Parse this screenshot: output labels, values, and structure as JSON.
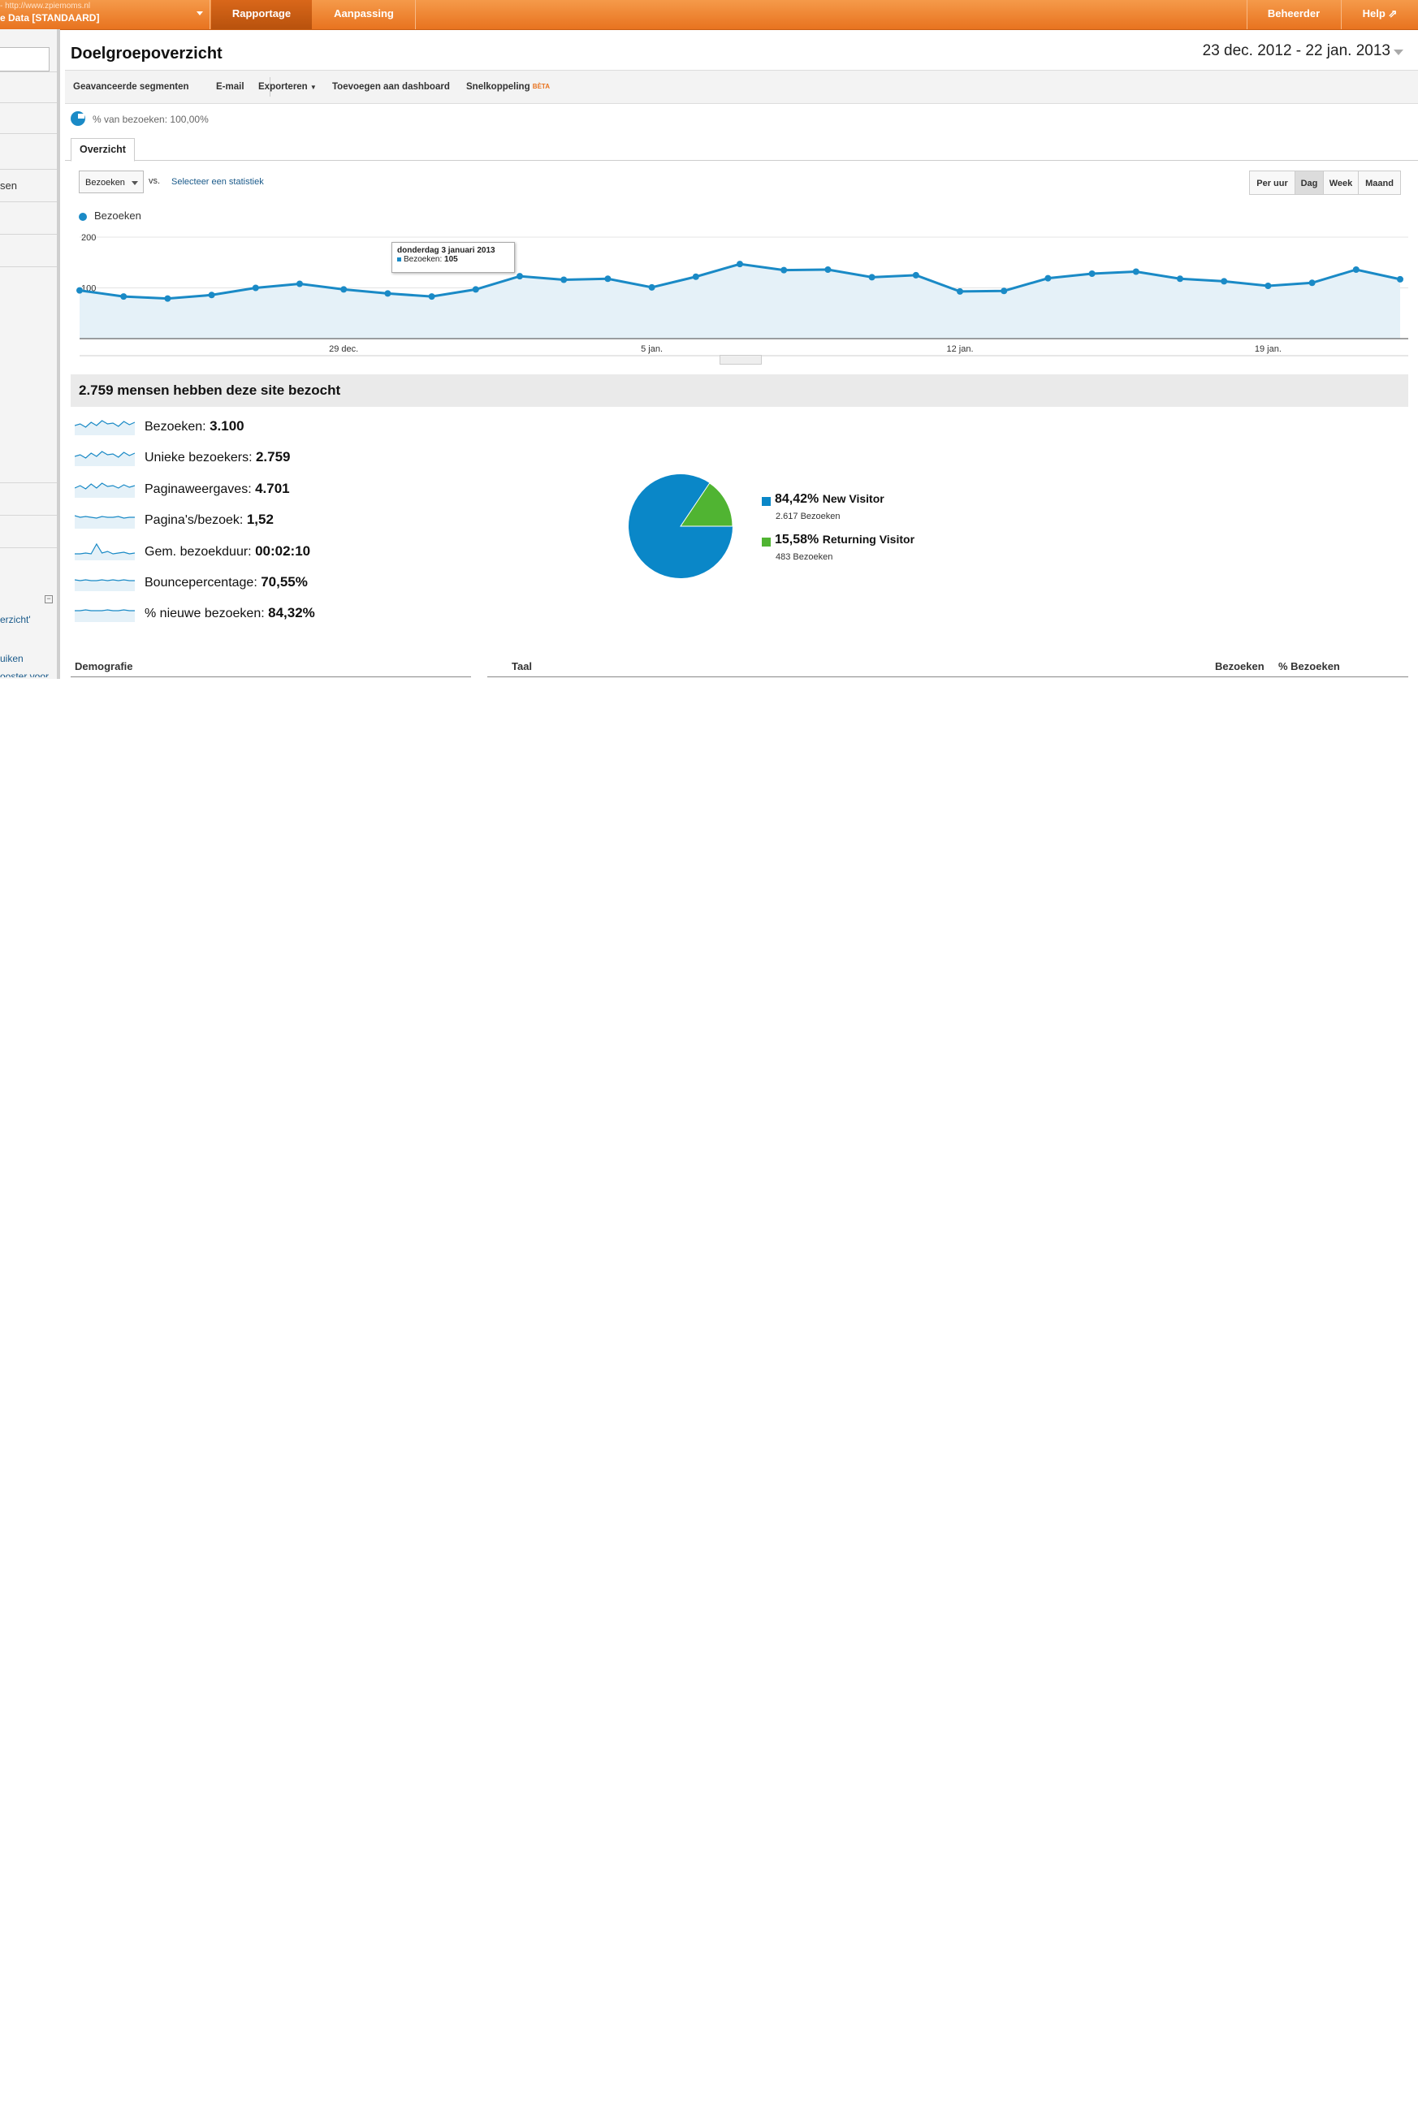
{
  "topbar": {
    "account_url": "- http://www.zpiemoms.nl",
    "account_name": "e Data [STANDAARD]",
    "tabs": [
      {
        "label": "Rapportage",
        "active": true
      },
      {
        "label": "Aanpassing",
        "active": false
      }
    ],
    "admin_label": "Beheerder",
    "help_label": "Help ⇗"
  },
  "sidebar": {
    "fragments": [
      "sen",
      "erzicht'",
      "uiken",
      "ooster voor"
    ],
    "collapse_glyph": "−"
  },
  "page": {
    "title": "Doelgroepoverzicht",
    "date_range": "23 dec. 2012 - 22 jan. 2013"
  },
  "toolbar": {
    "advanced_segments": "Geavanceerde segmenten",
    "email": "E-mail",
    "export": "Exporteren",
    "add_to_dashboard": "Toevoegen aan dashboard",
    "shortcut": "Snelkoppeling",
    "beta": "BÈTA"
  },
  "segment": {
    "text": "% van bezoeken: 100,00%"
  },
  "tabs": {
    "overview": "Overzicht"
  },
  "chart_controls": {
    "metric_select": "Bezoeken",
    "vs": "vs.",
    "select_metric": "Selecteer een statistiek",
    "granularity": [
      {
        "label": "Per uur",
        "active": false
      },
      {
        "label": "Dag",
        "active": true
      },
      {
        "label": "Week",
        "active": false
      },
      {
        "label": "Maand",
        "active": false
      }
    ]
  },
  "chart_data": {
    "type": "area",
    "series": [
      {
        "name": "Bezoeken",
        "color": "#1a8ac6",
        "values": [
          95,
          83,
          79,
          86,
          100,
          108,
          97,
          89,
          83,
          97,
          123,
          116,
          118,
          101,
          122,
          147,
          135,
          136,
          121,
          125,
          93,
          94,
          119,
          128,
          132,
          118,
          113,
          104,
          110,
          136,
          117
        ]
      }
    ],
    "x": [
      "23 dec.",
      "24 dec.",
      "25 dec.",
      "26 dec.",
      "27 dec.",
      "28 dec.",
      "29 dec.",
      "30 dec.",
      "31 dec.",
      "1 jan.",
      "2 jan.",
      "3 jan.",
      "4 jan.",
      "5 jan.",
      "6 jan.",
      "7 jan.",
      "8 jan.",
      "9 jan.",
      "10 jan.",
      "11 jan.",
      "12 jan.",
      "13 jan.",
      "14 jan.",
      "15 jan.",
      "16 jan.",
      "17 jan.",
      "18 jan.",
      "19 jan.",
      "20 jan.",
      "21 jan.",
      "22 jan."
    ],
    "x_tick_labels": [
      "29 dec.",
      "5 jan.",
      "12 jan.",
      "19 jan."
    ],
    "y_tick_labels": [
      "200",
      "100"
    ],
    "ylim": [
      0,
      200
    ],
    "grid": true,
    "tooltip": {
      "title": "donderdag 3 januari 2013",
      "series": "Bezoeken",
      "value": "105"
    }
  },
  "summary": {
    "headline": "2.759 mensen hebben deze site bezocht",
    "metrics": [
      {
        "label": "Bezoeken:",
        "value": "3.100"
      },
      {
        "label": "Unieke bezoekers:",
        "value": "2.759"
      },
      {
        "label": "Paginaweergaves:",
        "value": "4.701"
      },
      {
        "label": "Pagina's/bezoek:",
        "value": "1,52"
      },
      {
        "label": "Gem. bezoekduur:",
        "value": "00:02:10"
      },
      {
        "label": "Bouncepercentage:",
        "value": "70,55%"
      },
      {
        "label": "% nieuwe bezoeken:",
        "value": "84,32%"
      }
    ]
  },
  "pie": {
    "slices": [
      {
        "pct_label": "84,42%",
        "name": "New Visitor",
        "count": "2.617 Bezoeken",
        "fraction": 0.8442,
        "color": "#0a87c8"
      },
      {
        "pct_label": "15,58%",
        "name": "Returning Visitor",
        "count": "483 Bezoeken",
        "fraction": 0.1558,
        "color": "#50b432"
      }
    ]
  },
  "tables": {
    "demographics": "Demografie",
    "language": "Taal",
    "visits": "Bezoeken",
    "pct_visits": "% Bezoeken"
  }
}
